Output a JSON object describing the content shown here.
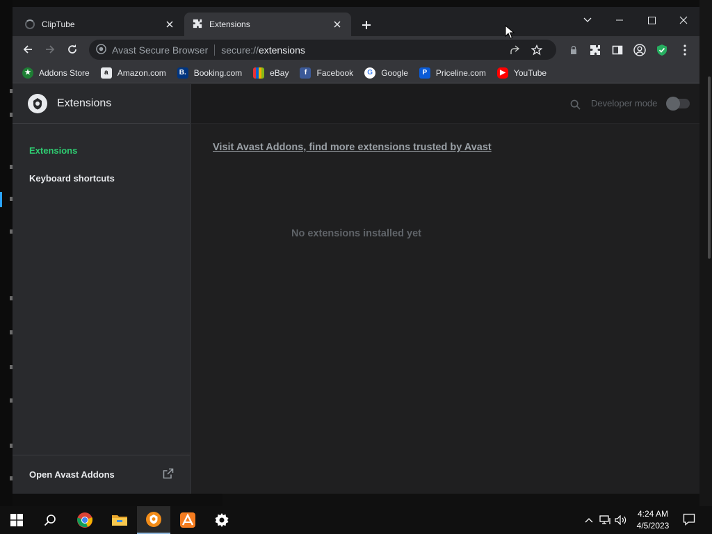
{
  "tabs": [
    {
      "title": "ClipTube",
      "state": "loading"
    },
    {
      "title": "Extensions",
      "state": "active"
    }
  ],
  "toolbar": {
    "omnibox_brand": "Avast Secure Browser",
    "url_scheme": "secure://",
    "url_path": "extensions"
  },
  "bookmarks": [
    {
      "label": "Addons Store",
      "icon": "avast-addons-icon",
      "color": "#1e7e34"
    },
    {
      "label": "Amazon.com",
      "icon": "amazon-icon",
      "color": "#e8eaed"
    },
    {
      "label": "Booking.com",
      "icon": "booking-icon",
      "color": "#003580"
    },
    {
      "label": "eBay",
      "icon": "ebay-icon",
      "color": "#e53238"
    },
    {
      "label": "Facebook",
      "icon": "facebook-icon",
      "color": "#3b5998"
    },
    {
      "label": "Google",
      "icon": "google-icon",
      "color": "#ffffff"
    },
    {
      "label": "Priceline.com",
      "icon": "priceline-icon",
      "color": "#0a5bd7"
    },
    {
      "label": "YouTube",
      "icon": "youtube-icon",
      "color": "#ff0000"
    }
  ],
  "sidebar": {
    "title": "Extensions",
    "items": [
      {
        "label": "Extensions",
        "selected": true
      },
      {
        "label": "Keyboard shortcuts",
        "selected": false
      }
    ],
    "bottom_link": "Open Avast Addons"
  },
  "main": {
    "developer_mode_label": "Developer mode",
    "developer_mode_on": false,
    "visit_link": "Visit Avast Addons, find more extensions trusted by Avast",
    "empty_message": "No extensions installed yet"
  },
  "colors": {
    "accent_green": "#2ecc71",
    "secure_shield": "#27ae60"
  },
  "taskbar": {
    "time": "4:24 AM",
    "date": "4/5/2023"
  }
}
